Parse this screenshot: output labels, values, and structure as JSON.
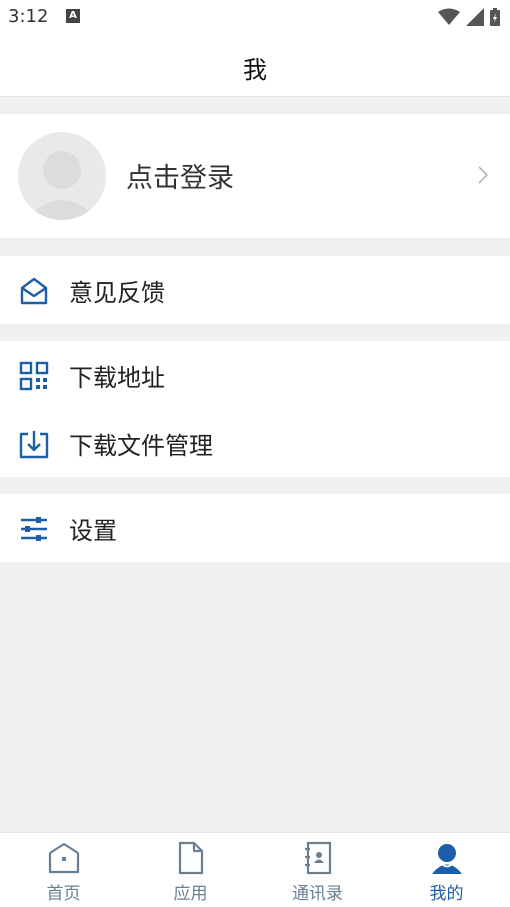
{
  "status_bar": {
    "time": "3:12",
    "notification_letter": "A"
  },
  "header": {
    "title": "我"
  },
  "profile": {
    "login_label": "点击登录"
  },
  "groups": [
    {
      "items": [
        {
          "label": "意见反馈",
          "icon": "envelope-icon"
        }
      ]
    },
    {
      "items": [
        {
          "label": "下载地址",
          "icon": "qr-code-icon"
        },
        {
          "label": "下载文件管理",
          "icon": "download-icon"
        }
      ]
    },
    {
      "items": [
        {
          "label": "设置",
          "icon": "sliders-icon"
        }
      ]
    }
  ],
  "bottom_nav": {
    "tabs": [
      {
        "label": "首页",
        "icon": "home-icon",
        "active": false
      },
      {
        "label": "应用",
        "icon": "document-icon",
        "active": false
      },
      {
        "label": "通讯录",
        "icon": "contacts-icon",
        "active": false
      },
      {
        "label": "我的",
        "icon": "user-icon",
        "active": true
      }
    ]
  },
  "colors": {
    "accent": "#1c5fa8",
    "inactive": "#6a7f92",
    "background": "#f0f0f0"
  }
}
